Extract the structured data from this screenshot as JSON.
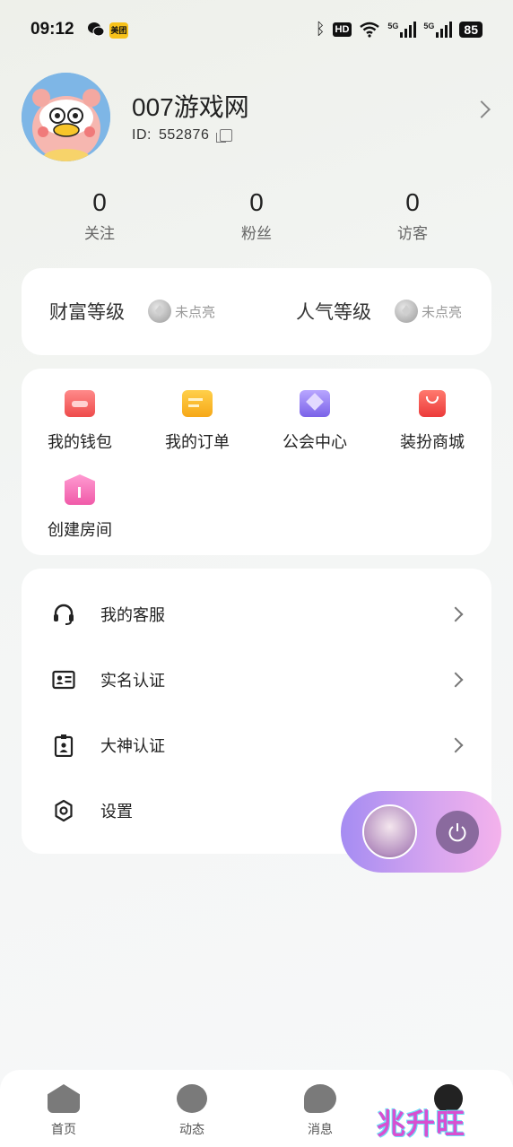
{
  "status_bar": {
    "time": "09:12",
    "meituan_label": "美团",
    "hd_label": "HD",
    "signal_1": "5G",
    "signal_2": "5G",
    "battery": "85"
  },
  "profile": {
    "name": "007游戏网",
    "id_label": "ID:",
    "id_value": "552876"
  },
  "stats": [
    {
      "value": "0",
      "label": "关注"
    },
    {
      "value": "0",
      "label": "粉丝"
    },
    {
      "value": "0",
      "label": "访客"
    }
  ],
  "levels": [
    {
      "title": "财富等级",
      "status": "未点亮"
    },
    {
      "title": "人气等级",
      "status": "未点亮"
    }
  ],
  "grid": [
    {
      "label": "我的钱包",
      "icon": "wallet-icon",
      "color": "#f25a5a"
    },
    {
      "label": "我的订单",
      "icon": "order-icon",
      "color": "#f7b322"
    },
    {
      "label": "公会中心",
      "icon": "guild-icon",
      "color": "#8a73f0"
    },
    {
      "label": "装扮商城",
      "icon": "shop-icon",
      "color": "#f24848"
    },
    {
      "label": "创建房间",
      "icon": "house-icon",
      "color": "#f062b0"
    }
  ],
  "menu": [
    {
      "label": "我的客服",
      "icon": "headset-icon"
    },
    {
      "label": "实名认证",
      "icon": "id-card-icon"
    },
    {
      "label": "大神认证",
      "icon": "badge-icon"
    },
    {
      "label": "设置",
      "icon": "gear-icon"
    }
  ],
  "nav": [
    {
      "label": "首页",
      "icon": "home-icon"
    },
    {
      "label": "动态",
      "icon": "feed-icon"
    },
    {
      "label": "消息",
      "icon": "message-icon"
    },
    {
      "label": "",
      "icon": "profile-icon"
    }
  ],
  "watermark": "兆升旺"
}
